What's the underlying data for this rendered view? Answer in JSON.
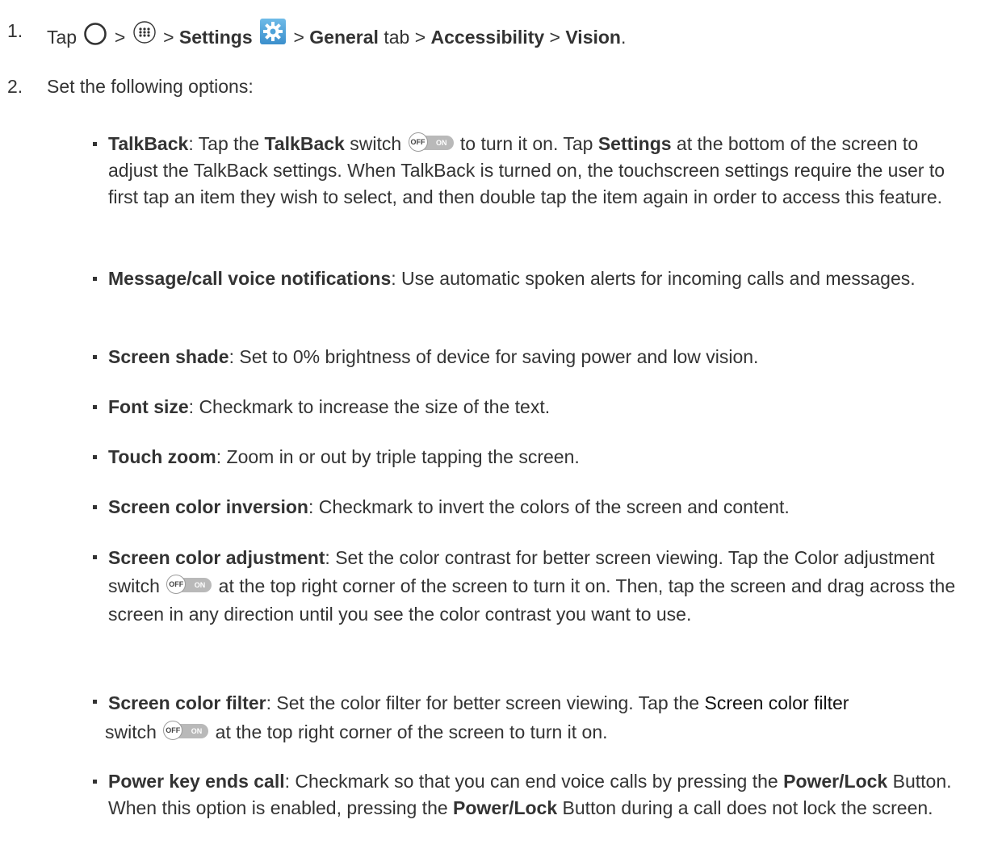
{
  "steps": [
    {
      "number": "1.",
      "tap": "Tap",
      "sep": ">",
      "settings": "Settings",
      "general": "General",
      "tab": "tab",
      "accessibility": "Accessibility",
      "vision": "Vision",
      "end": "."
    },
    {
      "number": "2.",
      "text": "Set the following options:"
    }
  ],
  "switch": {
    "off": "OFF",
    "on": "ON"
  },
  "items": {
    "talkback": {
      "title": "TalkBack",
      "p1": ": Tap the ",
      "b1": "TalkBack",
      "p2": " switch ",
      "p3": " to turn it on. Tap ",
      "b2": "Settings",
      "p4": " at the bottom of the screen to adjust the TalkBack settings. When TalkBack is turned on, the touchscreen settings require the user to first tap an item they wish to select, and then double tap the item again in order to access this feature."
    },
    "message_call": {
      "title": "Message/call voice notifications",
      "body": ": Use automatic spoken alerts for incoming calls and messages."
    },
    "screen_shade": {
      "title": "Screen shade",
      "body": ": Set to 0% brightness of device for saving power and low vision."
    },
    "font_size": {
      "title": "Font size",
      "body": ": Checkmark to increase the size of the text."
    },
    "touch_zoom": {
      "title": "Touch zoom",
      "body": ": Zoom in or out by triple tapping the screen."
    },
    "color_inversion": {
      "title": "Screen color inversion",
      "body": ": Checkmark to invert the colors of the screen and content."
    },
    "color_adjustment": {
      "title": "Screen color adjustment",
      "p1": ": Set the color contrast for better screen viewing. Tap the Color adjustment switch ",
      "p2": " at the top right corner of the screen to turn it on. Then, tap the screen and drag across the screen in any direction until you see the color contrast you want to use."
    },
    "color_filter": {
      "title": "Screen color filter",
      "p1": ": Set the color filter for better screen viewing. Tap the ",
      "p_mid": "Screen color filter",
      "p1b": " switch ",
      "p2": " at the top right corner of the screen to turn it on."
    },
    "power_key": {
      "title": "Power key ends call",
      "p1": ": Checkmark so that you can end voice calls by pressing the ",
      "b1": "Power/Lock",
      "p2": " Button. When this option is enabled, pressing the ",
      "b2": "Power/Lock",
      "p3": " Button during a call does not lock the screen."
    }
  },
  "icons": {
    "home": "home-circle-icon",
    "apps": "apps-grid-icon",
    "settings": "settings-gear-icon",
    "toggle": "off-on-switch-icon"
  },
  "colors": {
    "text": "#333333",
    "settings_icon_bg": "#4fa3d9",
    "switch_track": "#b9b9b9"
  }
}
